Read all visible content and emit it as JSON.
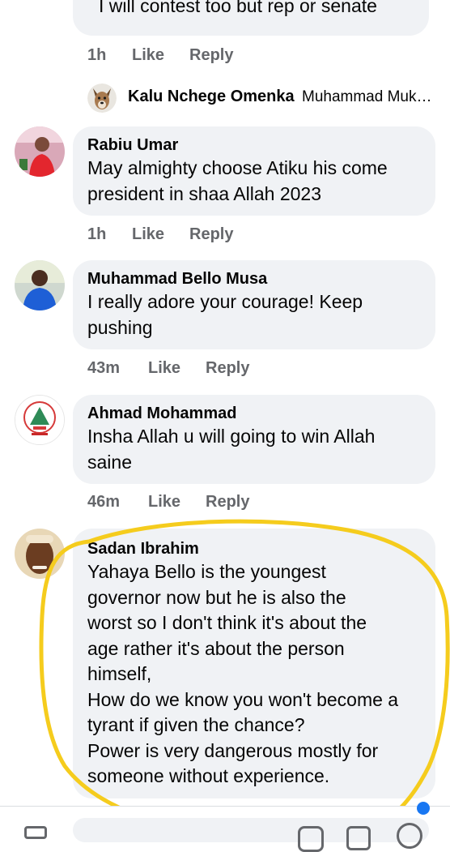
{
  "top_comment": {
    "text_partial": "I will contest too but rep or senate",
    "time": "1h",
    "like": "Like",
    "reply": "Reply"
  },
  "reply_preview": {
    "author": "Kalu Nchege Omenka",
    "text": "Muhammad Muk…"
  },
  "comments": [
    {
      "author": "Rabiu Umar",
      "text": "May almighty choose Atiku his come\npresident in shaa Allah 2023",
      "time": "1h",
      "like": "Like",
      "reply": "Reply"
    },
    {
      "author": "Muhammad Bello Musa",
      "text": "I really adore your courage! Keep\npushing",
      "time": "43m",
      "like": "Like",
      "reply": "Reply"
    },
    {
      "author": "Ahmad Mohammad",
      "text": "Insha Allah u will going to win Allah\nsaine",
      "time": "46m",
      "like": "Like",
      "reply": "Reply"
    },
    {
      "author": "Sadan Ibrahim",
      "text": "Yahaya Bello is the youngest\ngovernor now but he is also the\nworst so I don't think it's about the\nage rather it's about the person\nhimself,\nHow do we know you won't become a\ntyrant if given the chance?\nPower is very dangerous mostly for\nsomeone without experience."
    }
  ],
  "colors": {
    "bubble": "#f0f2f5",
    "meta_text": "#65676b",
    "highlight": "#f5cc1d"
  },
  "icons": [
    "dog-avatar-icon",
    "user-avatar-icon",
    "emoji-icon",
    "gif-icon",
    "sticker-icon",
    "camera-icon"
  ]
}
